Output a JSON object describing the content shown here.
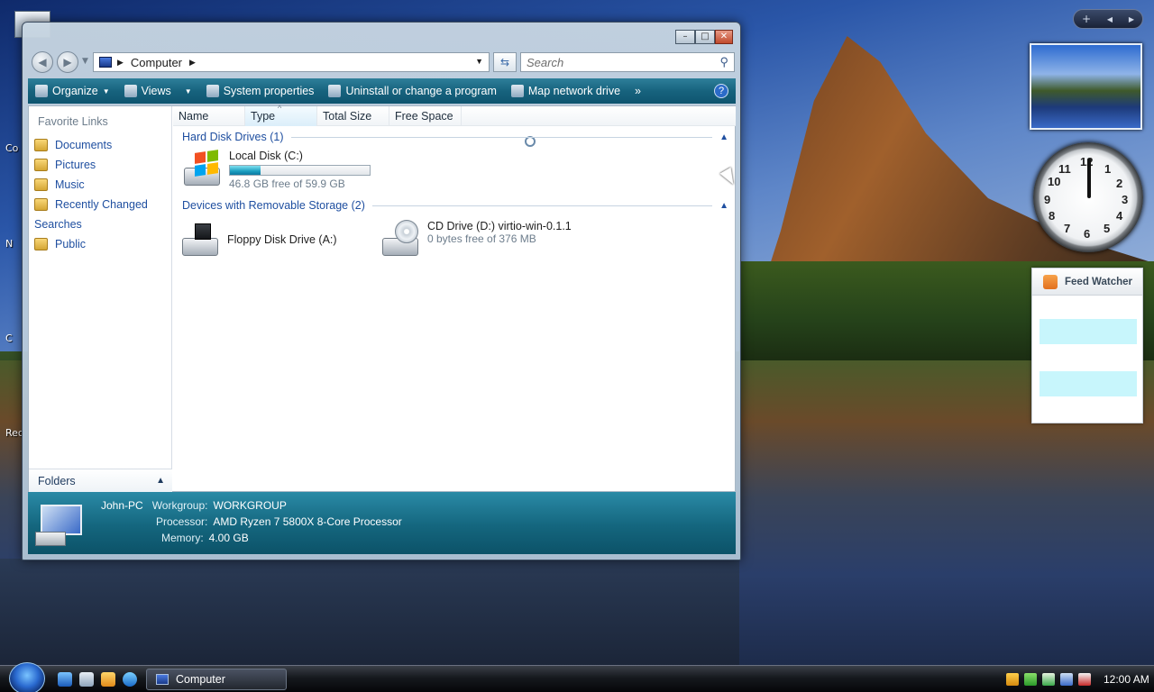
{
  "desktop": {
    "icon_labels": [
      "Co",
      "N",
      "C",
      "Rec"
    ]
  },
  "window": {
    "title": "Computer",
    "controls": {
      "minimize": "–",
      "maximize": "□",
      "close": "✕"
    },
    "address": {
      "crumb": "Computer"
    },
    "search": {
      "placeholder": "Search"
    },
    "toolbar": {
      "organize": "Organize",
      "views": "Views",
      "system_properties": "System properties",
      "uninstall": "Uninstall or change a program",
      "map_drive": "Map network drive",
      "more": "»",
      "help": "?"
    },
    "left_pane": {
      "title": "Favorite Links",
      "items": [
        {
          "label": "Documents",
          "icon": "documents-icon"
        },
        {
          "label": "Pictures",
          "icon": "pictures-icon"
        },
        {
          "label": "Music",
          "icon": "music-icon"
        },
        {
          "label": "Recently Changed",
          "icon": "recent-icon"
        },
        {
          "label": "Searches",
          "icon": "search-icon"
        },
        {
          "label": "Public",
          "icon": "public-icon"
        }
      ],
      "folders_label": "Folders"
    },
    "columns": [
      "Name",
      "Type",
      "Total Size",
      "Free Space"
    ],
    "groups": {
      "hdd": "Hard Disk Drives (1)",
      "removable": "Devices with Removable Storage (2)"
    },
    "drives": {
      "c": {
        "name": "Local Disk (C:)",
        "free": "46.8 GB free of 59.9 GB",
        "used_fraction": 0.22
      },
      "a": {
        "name": "Floppy Disk Drive (A:)"
      },
      "d": {
        "name": "CD Drive (D:) virtio-win-0.1.1",
        "free": "0 bytes free of 376 MB"
      }
    },
    "details": {
      "computer_name": "John-PC",
      "workgroup_label": "Workgroup:",
      "workgroup": "WORKGROUP",
      "processor_label": "Processor:",
      "processor": "AMD Ryzen 7 5800X 8-Core Processor",
      "memory_label": "Memory:",
      "memory": "4.00 GB"
    }
  },
  "sidebar": {
    "controls": {
      "add": "+",
      "prev": "◀",
      "next": "▶"
    },
    "clock_numbers": [
      "12",
      "1",
      "2",
      "3",
      "4",
      "5",
      "6",
      "7",
      "8",
      "9",
      "10",
      "11"
    ],
    "feed_title": "Feed Watcher"
  },
  "taskbar": {
    "task_label": "Computer",
    "time": "12:00 AM"
  },
  "colors": {
    "toolbar_teal": "#17637e",
    "link_blue": "#1f4fa0",
    "drive_bar": "#1c9ec0"
  }
}
